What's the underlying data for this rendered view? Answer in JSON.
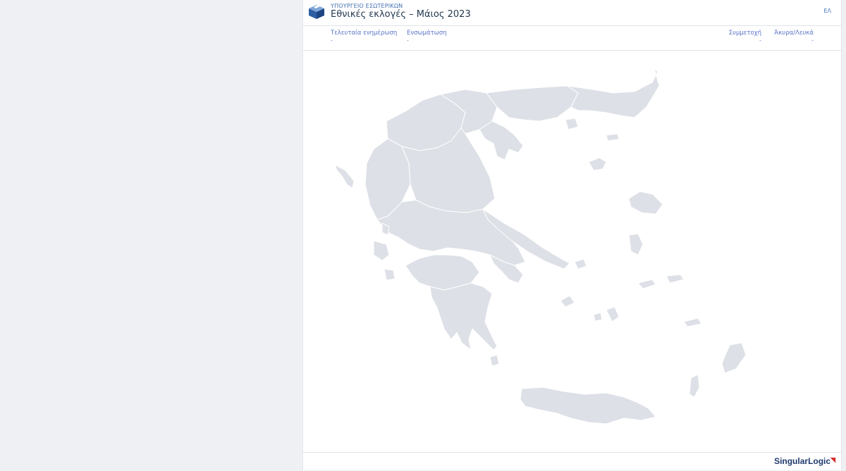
{
  "header": {
    "ministry": "ΥΠΟΥΡΓΕΙΟ ΕΣΩΤΕΡΙΚΩΝ",
    "title": "Εθνικές εκλογές – Μάιος 2023",
    "lang": "ΕΛ",
    "logo_icon": "ballot-box-icon"
  },
  "stats": {
    "last_update": {
      "label": "Τελευταία ενημέρωση",
      "value": "-"
    },
    "integration": {
      "label": "Ενσωμάτωση",
      "value": "-"
    },
    "turnout": {
      "label": "Συμμετοχή",
      "value": "-"
    },
    "invalid_blank": {
      "label": "Άκυρα/Λευκά",
      "value": "-"
    }
  },
  "map": {
    "region_fill": "#dde0e6",
    "border_color": "#ffffff"
  },
  "footer": {
    "brand": "SingularLogic",
    "brand_mark": "◥"
  }
}
